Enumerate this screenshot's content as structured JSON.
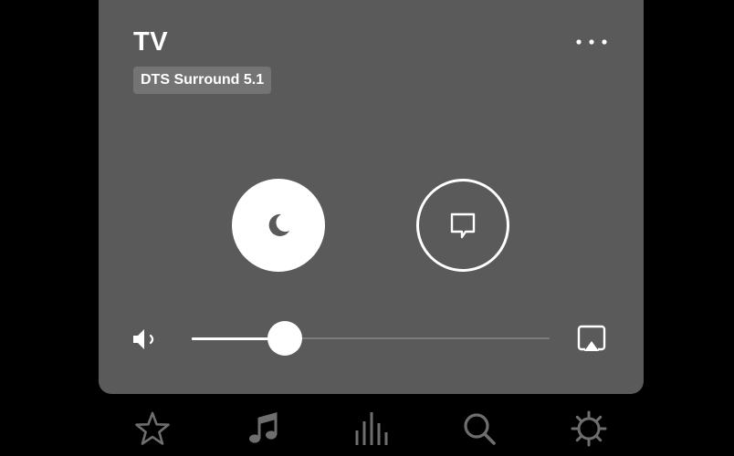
{
  "panel": {
    "title": "TV",
    "audio_format": "DTS Surround 5.1"
  },
  "controls": {
    "night_mode_icon": "moon-icon",
    "speech_enhancement_icon": "speech-bubble-icon"
  },
  "volume": {
    "icon": "speaker-icon",
    "level": 0.26,
    "output_icon": "airplay-icon"
  },
  "tabs": [
    {
      "icon": "star-icon",
      "name": "favorites"
    },
    {
      "icon": "music-note-icon",
      "name": "music"
    },
    {
      "icon": "equalizer-bars-icon",
      "name": "rooms"
    },
    {
      "icon": "search-icon",
      "name": "search"
    },
    {
      "icon": "gear-icon",
      "name": "settings"
    }
  ],
  "colors": {
    "background": "#000000",
    "panel": "#5a5a5a",
    "badge": "#747474",
    "foreground": "#ffffff",
    "tab_icon": "#6e6e6e"
  }
}
